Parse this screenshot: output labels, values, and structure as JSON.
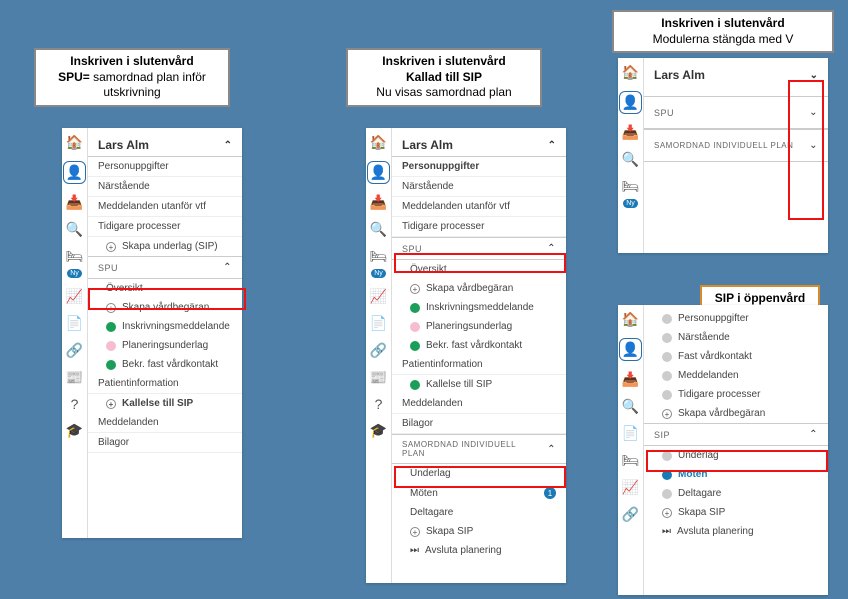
{
  "labels": {
    "p1_line1": "Inskriven i slutenvård",
    "p1_line2_b": "SPU=",
    "p1_line2": " samordnad plan inför utskrivning",
    "p2_line1": "Inskriven i slutenvård",
    "p2_line2": "Kallad till SIP",
    "p2_line3": "Nu visas samordnad plan",
    "p3_line1": "Inskriven i slutenvård",
    "p3_line2": "Modulerna stängda med  V",
    "p4": "SIP i öppenvård"
  },
  "patient": "Lars Alm",
  "nyBadge": "Ny",
  "icons": {
    "home": "home-icon",
    "person": "person-icon",
    "inbox": "inbox-icon",
    "search": "search-icon",
    "bed": "bed-icon",
    "chart": "chart-icon",
    "doc": "document-icon",
    "link": "link-icon",
    "news": "news-icon",
    "help": "help-icon",
    "grad": "graduation-icon"
  },
  "panel1": {
    "items": [
      "Personuppgifter",
      "Närstående",
      "Meddelanden utanför vtf",
      "Tidigare processer"
    ],
    "skapa": "Skapa underlag (SIP)",
    "spuHdr": "SPU",
    "subs": [
      "Översikt",
      "Skapa vårdbegäran",
      "Inskrivningsmeddelande",
      "Planeringsunderlag",
      "Bekr. fast vårdkontakt",
      "Patientinformation"
    ],
    "kallelse": "Kallelse till SIP",
    "tail": [
      "Meddelanden",
      "Bilagor"
    ]
  },
  "panel2": {
    "items": [
      "Personuppgifter",
      "Närstående",
      "Meddelanden utanför vtf",
      "Tidigare processer"
    ],
    "spuHdr": "SPU",
    "subs": [
      "Översikt",
      "Skapa vårdbegäran",
      "Inskrivningsmeddelande",
      "Planeringsunderlag",
      "Bekr. fast vårdkontakt",
      "Patientinformation",
      "Kallelse till SIP",
      "Meddelanden",
      "Bilagor"
    ],
    "samHdr": "SAMORDNAD INDIVIDUELL PLAN",
    "sam": [
      "Underlag",
      "Möten",
      "Deltagare",
      "Skapa SIP",
      "Avsluta planering"
    ],
    "motenBadge": "1"
  },
  "panel3": {
    "spuHdr": "SPU",
    "samHdr": "SAMORDNAD INDIVIDUELL PLAN"
  },
  "panel4": {
    "items": [
      "Personuppgifter",
      "Närstående",
      "Fast vårdkontakt",
      "Meddelanden",
      "Tidigare processer"
    ],
    "skapa": "Skapa vårdbegäran",
    "sipHdr": "SIP",
    "subs": [
      "Underlag",
      "Möten",
      "Deltagare",
      "Skapa SIP",
      "Avsluta planering"
    ]
  }
}
